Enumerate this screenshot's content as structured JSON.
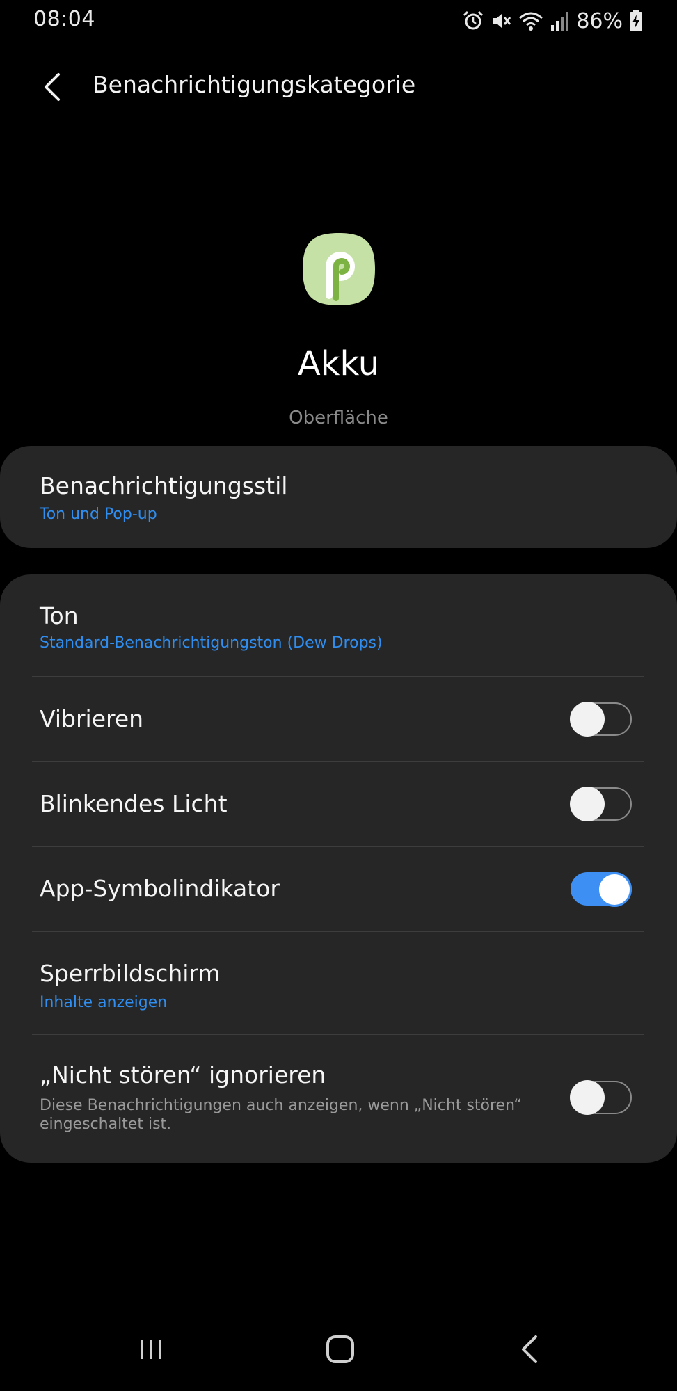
{
  "status_bar": {
    "time": "08:04",
    "battery": "86%",
    "icons": [
      "alarm-icon",
      "mute-icon",
      "wifi-icon",
      "signal-icon",
      "battery-charging-icon"
    ]
  },
  "app_bar": {
    "back_icon": "back-arrow-icon",
    "title": "Benachrichtigungskategorie"
  },
  "header": {
    "app_icon": "android-p-icon",
    "app_name": "Akku",
    "category_group": "Oberfläche"
  },
  "style_card": {
    "title": "Benachrichtigungsstil",
    "value": "Ton und Pop-up"
  },
  "settings": {
    "sound": {
      "title": "Ton",
      "value": "Standard-Benachrichtigungston (Dew Drops)"
    },
    "vibrate": {
      "title": "Vibrieren",
      "enabled": false
    },
    "blink_light": {
      "title": "Blinkendes Licht",
      "enabled": false
    },
    "badge": {
      "title": "App-Symbolindikator",
      "enabled": true
    },
    "lockscreen": {
      "title": "Sperrbildschirm",
      "value": "Inhalte anzeigen"
    },
    "dnd_override": {
      "title": "„Nicht stören“ ignorieren",
      "description": "Diese Benachrichtigungen auch anzeigen, wenn „Nicht stören“ eingeschaltet ist.",
      "enabled": false
    }
  },
  "nav_bar": {
    "items": [
      "recent-apps-icon",
      "home-icon",
      "back-icon"
    ]
  },
  "colors": {
    "background": "#000000",
    "card": "#262626",
    "accent": "#3e8ff3",
    "link_text": "#2f8ef0",
    "icon_bg": "#c5e1a5",
    "icon_fg": "#7cb342"
  }
}
